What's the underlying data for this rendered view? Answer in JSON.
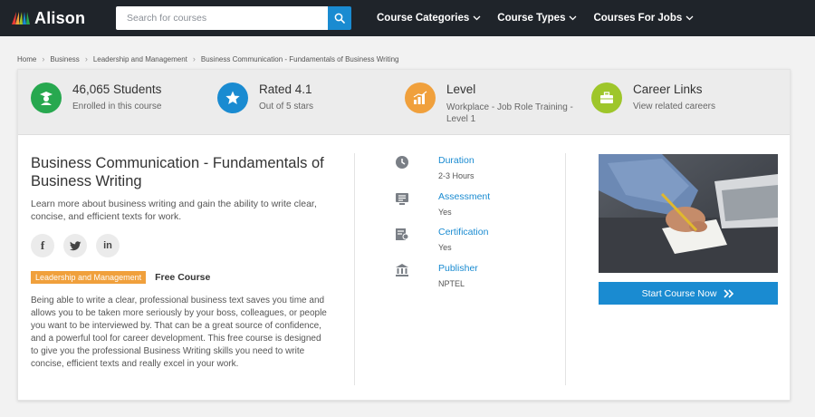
{
  "header": {
    "logo_text": "Alison",
    "search_placeholder": "Search for courses",
    "nav": [
      {
        "label": "Course Categories"
      },
      {
        "label": "Course Types"
      },
      {
        "label": "Courses For Jobs"
      }
    ]
  },
  "breadcrumb": [
    "Home",
    "Business",
    "Leadership and Management",
    "Business Communication - Fundamentals of Business Writing"
  ],
  "stats": {
    "students": {
      "title": "46,065 Students",
      "sub": "Enrolled in this course",
      "icon": "student-icon",
      "color": "#27a84f"
    },
    "rating": {
      "title": "Rated 4.1",
      "sub": "Out of 5 stars",
      "icon": "star-icon",
      "color": "#1a8bd1"
    },
    "level": {
      "title": "Level",
      "sub": "Workplace - Job Role Training - Level 1",
      "icon": "bar-chart-icon",
      "color": "#f0a03c"
    },
    "career": {
      "title": "Career Links",
      "sub": "View related careers",
      "icon": "briefcase-icon",
      "color": "#9ec62a"
    }
  },
  "course": {
    "title": "Business Communication - Fundamentals of Business Writing",
    "short_desc": "Learn more about business writing and gain the ability to write clear, concise, and efficient texts for work.",
    "tag": "Leadership and Management",
    "price_label": "Free Course",
    "long_desc": "Being able to write a clear, professional business text saves you time and allows you to be taken more seriously by your boss, colleagues, or people you want to be interviewed by. That can be a great source of confidence, and a powerful tool for career development. This free course is designed to give you the professional Business Writing skills you need to write concise, efficient texts and really excel in your work."
  },
  "social": [
    "f",
    "twitter-icon",
    "in"
  ],
  "details": {
    "duration": {
      "label": "Duration",
      "value": "2-3 Hours",
      "icon": "clock-icon"
    },
    "assessment": {
      "label": "Assessment",
      "value": "Yes",
      "icon": "assessment-icon"
    },
    "certification": {
      "label": "Certification",
      "value": "Yes",
      "icon": "certificate-icon"
    },
    "publisher": {
      "label": "Publisher",
      "value": "NPTEL",
      "icon": "institution-icon"
    }
  },
  "cta": {
    "label": "Start Course Now"
  },
  "colors": {
    "accent": "#1a8bd1",
    "nav_bg": "#1f242a",
    "tag": "#f0a03c"
  }
}
